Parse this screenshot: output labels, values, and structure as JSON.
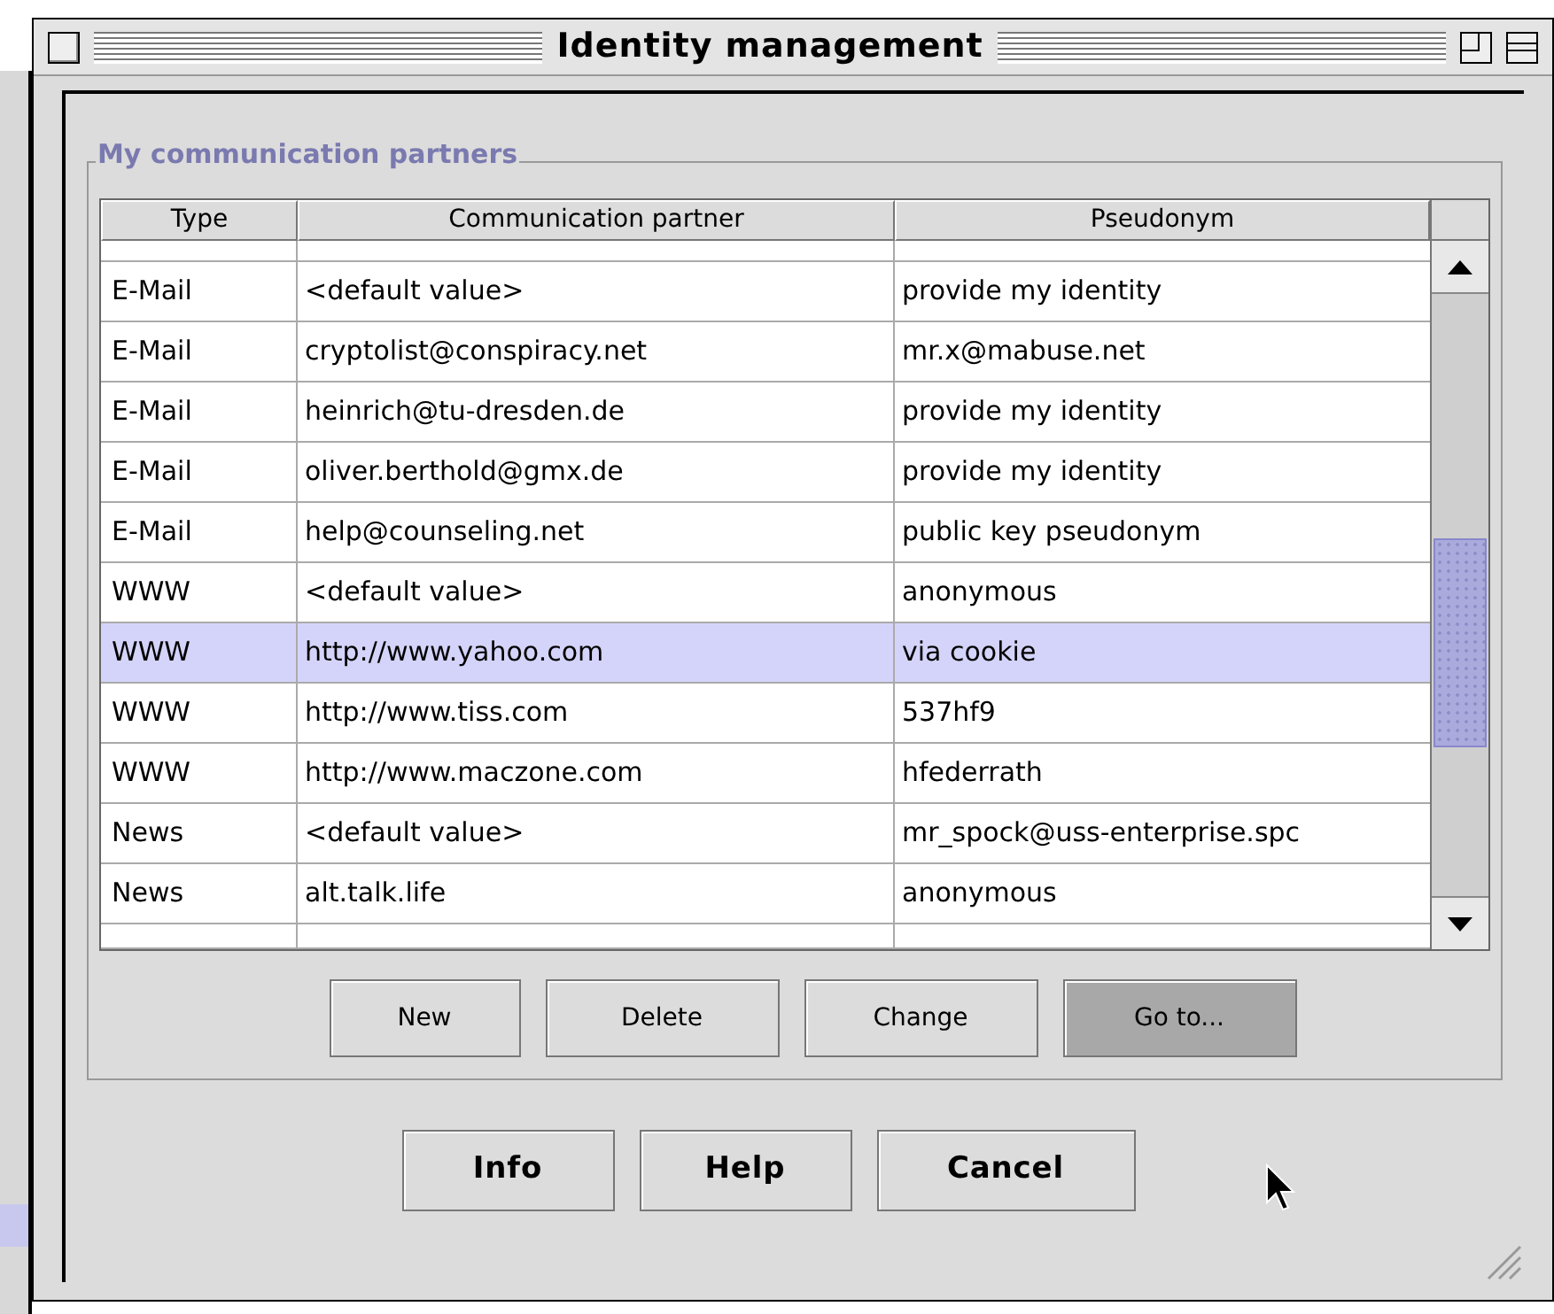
{
  "window": {
    "title": "Identity management"
  },
  "group": {
    "title": "My communication partners"
  },
  "table": {
    "columns": [
      "Type",
      "Communication partner",
      "Pseudonym"
    ],
    "rows": [
      {
        "type": "E-Mail",
        "partner": "<default value>",
        "pseudonym": "provide my identity",
        "selected": false
      },
      {
        "type": "E-Mail",
        "partner": "cryptolist@conspiracy.net",
        "pseudonym": "mr.x@mabuse.net",
        "selected": false
      },
      {
        "type": "E-Mail",
        "partner": "heinrich@tu-dresden.de",
        "pseudonym": "provide my identity",
        "selected": false
      },
      {
        "type": "E-Mail",
        "partner": "oliver.berthold@gmx.de",
        "pseudonym": "provide my identity",
        "selected": false
      },
      {
        "type": "E-Mail",
        "partner": "help@counseling.net",
        "pseudonym": "public key pseudonym",
        "selected": false
      },
      {
        "type": "WWW",
        "partner": "<default value>",
        "pseudonym": "anonymous",
        "selected": false
      },
      {
        "type": "WWW",
        "partner": "http://www.yahoo.com",
        "pseudonym": "via cookie",
        "selected": true
      },
      {
        "type": "WWW",
        "partner": "http://www.tiss.com",
        "pseudonym": "537hf9",
        "selected": false
      },
      {
        "type": "WWW",
        "partner": "http://www.maczone.com",
        "pseudonym": "hfederrath",
        "selected": false
      },
      {
        "type": "News",
        "partner": "<default value>",
        "pseudonym": "mr_spock@uss-enterprise.spc",
        "selected": false
      },
      {
        "type": "News",
        "partner": "alt.talk.life",
        "pseudonym": "anonymous",
        "selected": false
      }
    ]
  },
  "actions": [
    {
      "label": "New",
      "pressed": false
    },
    {
      "label": "Delete",
      "pressed": false
    },
    {
      "label": "Change",
      "pressed": false
    },
    {
      "label": "Go to...",
      "pressed": true
    }
  ],
  "buttons": [
    "Info",
    "Help",
    "Cancel"
  ]
}
